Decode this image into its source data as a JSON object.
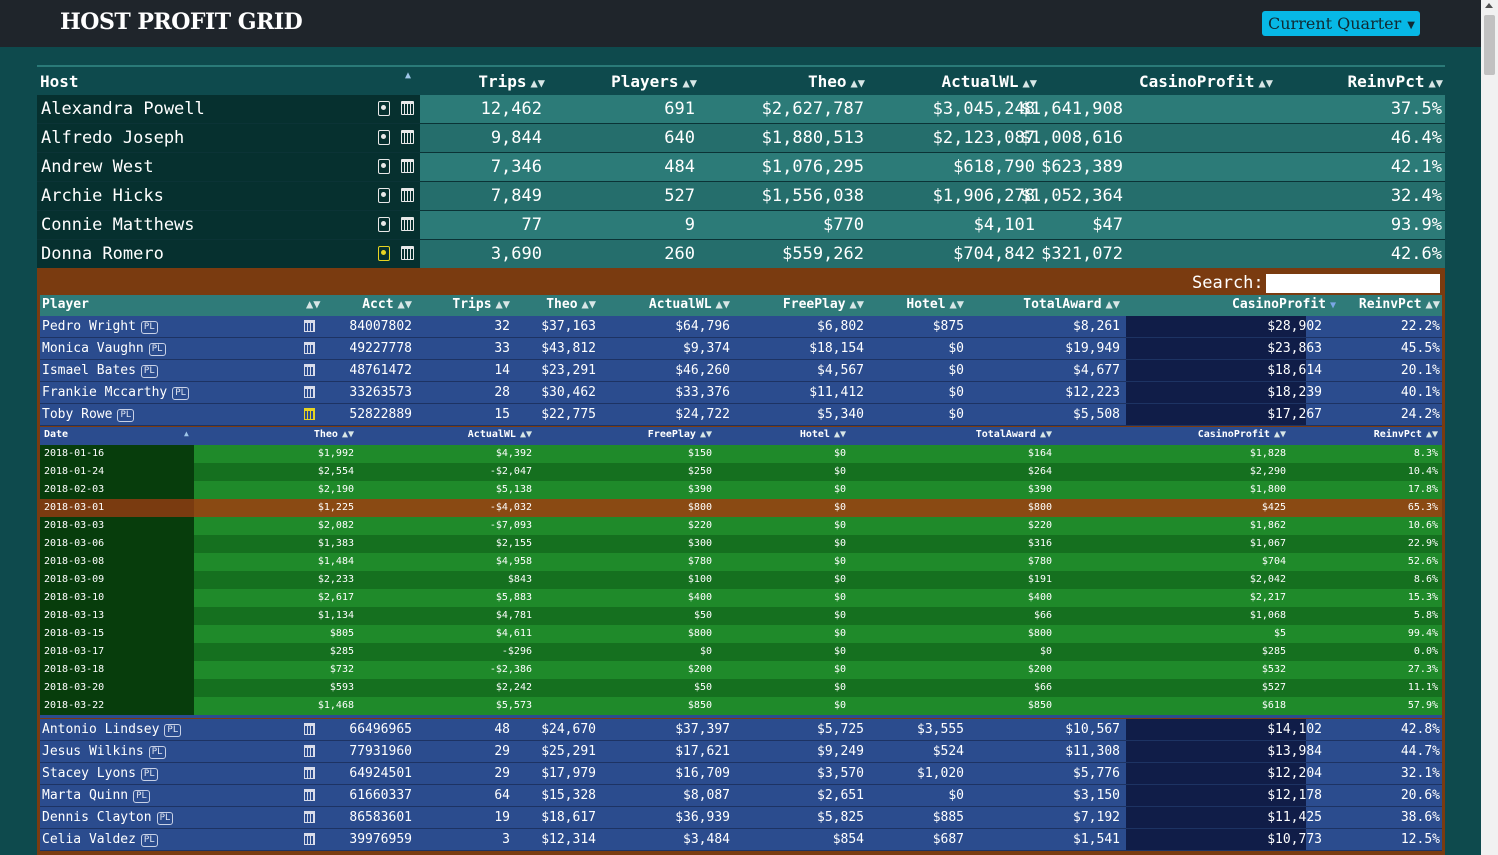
{
  "app": {
    "title": "HOST PROFIT GRID",
    "period": "Current Quarter"
  },
  "host_table": {
    "columns": [
      "Host",
      "Trips",
      "Players",
      "Theo",
      "ActualWL",
      "CasinoProfit",
      "ReinvPct"
    ],
    "rows": [
      {
        "host": "Alexandra Powell",
        "trips": "12,462",
        "players": "691",
        "theo": "$2,627,787",
        "actualwl": "$3,045,248",
        "profit": "$1,641,908",
        "reinv": "37.5%"
      },
      {
        "host": "Alfredo Joseph",
        "trips": "9,844",
        "players": "640",
        "theo": "$1,880,513",
        "actualwl": "$2,123,087",
        "profit": "$1,008,616",
        "reinv": "46.4%"
      },
      {
        "host": "Andrew West",
        "trips": "7,346",
        "players": "484",
        "theo": "$1,076,295",
        "actualwl": "$618,790",
        "profit": "$623,389",
        "reinv": "42.1%"
      },
      {
        "host": "Archie Hicks",
        "trips": "7,849",
        "players": "527",
        "theo": "$1,556,038",
        "actualwl": "$1,906,278",
        "profit": "$1,052,364",
        "reinv": "32.4%"
      },
      {
        "host": "Connie Matthews",
        "trips": "77",
        "players": "9",
        "theo": "$770",
        "actualwl": "$4,101",
        "profit": "$47",
        "reinv": "93.9%"
      },
      {
        "host": "Donna Romero",
        "trips": "3,690",
        "players": "260",
        "theo": "$559,262",
        "actualwl": "$704,842",
        "profit": "$321,072",
        "reinv": "42.6%"
      }
    ]
  },
  "search": {
    "label": "Search:",
    "value": ""
  },
  "player_table": {
    "columns": [
      "Player",
      "Acct",
      "Trips",
      "Theo",
      "ActualWL",
      "FreePlay",
      "Hotel",
      "TotalAward",
      "CasinoProfit",
      "ReinvPct"
    ],
    "badge": "PL",
    "rows_top": [
      {
        "name": "Pedro Wright",
        "acct": "84007802",
        "trips": "32",
        "theo": "$37,163",
        "actualwl": "$64,796",
        "freeplay": "$6,802",
        "hotel": "$875",
        "award": "$8,261",
        "profit": "$28,902",
        "reinv": "22.2%"
      },
      {
        "name": "Monica Vaughn",
        "acct": "49227778",
        "trips": "33",
        "theo": "$43,812",
        "actualwl": "$9,374",
        "freeplay": "$18,154",
        "hotel": "$0",
        "award": "$19,949",
        "profit": "$23,863",
        "reinv": "45.5%"
      },
      {
        "name": "Ismael Bates",
        "acct": "48761472",
        "trips": "14",
        "theo": "$23,291",
        "actualwl": "$46,260",
        "freeplay": "$4,567",
        "hotel": "$0",
        "award": "$4,677",
        "profit": "$18,614",
        "reinv": "20.1%"
      },
      {
        "name": "Frankie Mccarthy",
        "acct": "33263573",
        "trips": "28",
        "theo": "$30,462",
        "actualwl": "$33,376",
        "freeplay": "$11,412",
        "hotel": "$0",
        "award": "$12,223",
        "profit": "$18,239",
        "reinv": "40.1%"
      },
      {
        "name": "Toby Rowe",
        "acct": "52822889",
        "trips": "15",
        "theo": "$22,775",
        "actualwl": "$24,722",
        "freeplay": "$5,340",
        "hotel": "$0",
        "award": "$5,508",
        "profit": "$17,267",
        "reinv": "24.2%"
      }
    ],
    "rows_bottom": [
      {
        "name": "Antonio Lindsey",
        "acct": "66496965",
        "trips": "48",
        "theo": "$24,670",
        "actualwl": "$37,397",
        "freeplay": "$5,725",
        "hotel": "$3,555",
        "award": "$10,567",
        "profit": "$14,102",
        "reinv": "42.8%"
      },
      {
        "name": "Jesus Wilkins",
        "acct": "77931960",
        "trips": "29",
        "theo": "$25,291",
        "actualwl": "$17,621",
        "freeplay": "$9,249",
        "hotel": "$524",
        "award": "$11,308",
        "profit": "$13,984",
        "reinv": "44.7%"
      },
      {
        "name": "Stacey Lyons",
        "acct": "64924501",
        "trips": "29",
        "theo": "$17,979",
        "actualwl": "$16,709",
        "freeplay": "$3,570",
        "hotel": "$1,020",
        "award": "$5,776",
        "profit": "$12,204",
        "reinv": "32.1%"
      },
      {
        "name": "Marta Quinn",
        "acct": "61660337",
        "trips": "64",
        "theo": "$15,328",
        "actualwl": "$8,087",
        "freeplay": "$2,651",
        "hotel": "$0",
        "award": "$3,150",
        "profit": "$12,178",
        "reinv": "20.6%"
      },
      {
        "name": "Dennis Clayton",
        "acct": "86583601",
        "trips": "19",
        "theo": "$18,617",
        "actualwl": "$36,939",
        "freeplay": "$5,825",
        "hotel": "$885",
        "award": "$7,192",
        "profit": "$11,425",
        "reinv": "38.6%"
      },
      {
        "name": "Celia Valdez",
        "acct": "39976959",
        "trips": "3",
        "theo": "$12,314",
        "actualwl": "$3,484",
        "freeplay": "$854",
        "hotel": "$687",
        "award": "$1,541",
        "profit": "$10,773",
        "reinv": "12.5%"
      }
    ]
  },
  "date_table": {
    "columns": [
      "Date",
      "Theo",
      "ActualWL",
      "FreePlay",
      "Hotel",
      "TotalAward",
      "CasinoProfit",
      "ReinvPct"
    ],
    "rows": [
      {
        "date": "2018-01-16",
        "theo": "$1,992",
        "actualwl": "$4,392",
        "freeplay": "$150",
        "hotel": "$0",
        "award": "$164",
        "profit": "$1,828",
        "reinv": "8.3%"
      },
      {
        "date": "2018-01-24",
        "theo": "$2,554",
        "actualwl": "-$2,047",
        "freeplay": "$250",
        "hotel": "$0",
        "award": "$264",
        "profit": "$2,290",
        "reinv": "10.4%"
      },
      {
        "date": "2018-02-03",
        "theo": "$2,190",
        "actualwl": "$5,138",
        "freeplay": "$390",
        "hotel": "$0",
        "award": "$390",
        "profit": "$1,800",
        "reinv": "17.8%"
      },
      {
        "date": "2018-03-01",
        "theo": "$1,225",
        "actualwl": "-$4,032",
        "freeplay": "$800",
        "hotel": "$0",
        "award": "$800",
        "profit": "$425",
        "reinv": "65.3%"
      },
      {
        "date": "2018-03-03",
        "theo": "$2,082",
        "actualwl": "-$7,093",
        "freeplay": "$220",
        "hotel": "$0",
        "award": "$220",
        "profit": "$1,862",
        "reinv": "10.6%"
      },
      {
        "date": "2018-03-06",
        "theo": "$1,383",
        "actualwl": "$2,155",
        "freeplay": "$300",
        "hotel": "$0",
        "award": "$316",
        "profit": "$1,067",
        "reinv": "22.9%"
      },
      {
        "date": "2018-03-08",
        "theo": "$1,484",
        "actualwl": "$4,958",
        "freeplay": "$780",
        "hotel": "$0",
        "award": "$780",
        "profit": "$704",
        "reinv": "52.6%"
      },
      {
        "date": "2018-03-09",
        "theo": "$2,233",
        "actualwl": "$843",
        "freeplay": "$100",
        "hotel": "$0",
        "award": "$191",
        "profit": "$2,042",
        "reinv": "8.6%"
      },
      {
        "date": "2018-03-10",
        "theo": "$2,617",
        "actualwl": "$5,883",
        "freeplay": "$400",
        "hotel": "$0",
        "award": "$400",
        "profit": "$2,217",
        "reinv": "15.3%"
      },
      {
        "date": "2018-03-13",
        "theo": "$1,134",
        "actualwl": "$4,781",
        "freeplay": "$50",
        "hotel": "$0",
        "award": "$66",
        "profit": "$1,068",
        "reinv": "5.8%"
      },
      {
        "date": "2018-03-15",
        "theo": "$805",
        "actualwl": "$4,611",
        "freeplay": "$800",
        "hotel": "$0",
        "award": "$800",
        "profit": "$5",
        "reinv": "99.4%"
      },
      {
        "date": "2018-03-17",
        "theo": "$285",
        "actualwl": "-$296",
        "freeplay": "$0",
        "hotel": "$0",
        "award": "$0",
        "profit": "$285",
        "reinv": "0.0%"
      },
      {
        "date": "2018-03-18",
        "theo": "$732",
        "actualwl": "-$2,386",
        "freeplay": "$200",
        "hotel": "$0",
        "award": "$200",
        "profit": "$532",
        "reinv": "27.3%"
      },
      {
        "date": "2018-03-20",
        "theo": "$593",
        "actualwl": "$2,242",
        "freeplay": "$50",
        "hotel": "$0",
        "award": "$66",
        "profit": "$527",
        "reinv": "11.1%"
      },
      {
        "date": "2018-03-22",
        "theo": "$1,468",
        "actualwl": "$5,573",
        "freeplay": "$850",
        "hotel": "$0",
        "award": "$850",
        "profit": "$618",
        "reinv": "57.9%"
      }
    ]
  }
}
